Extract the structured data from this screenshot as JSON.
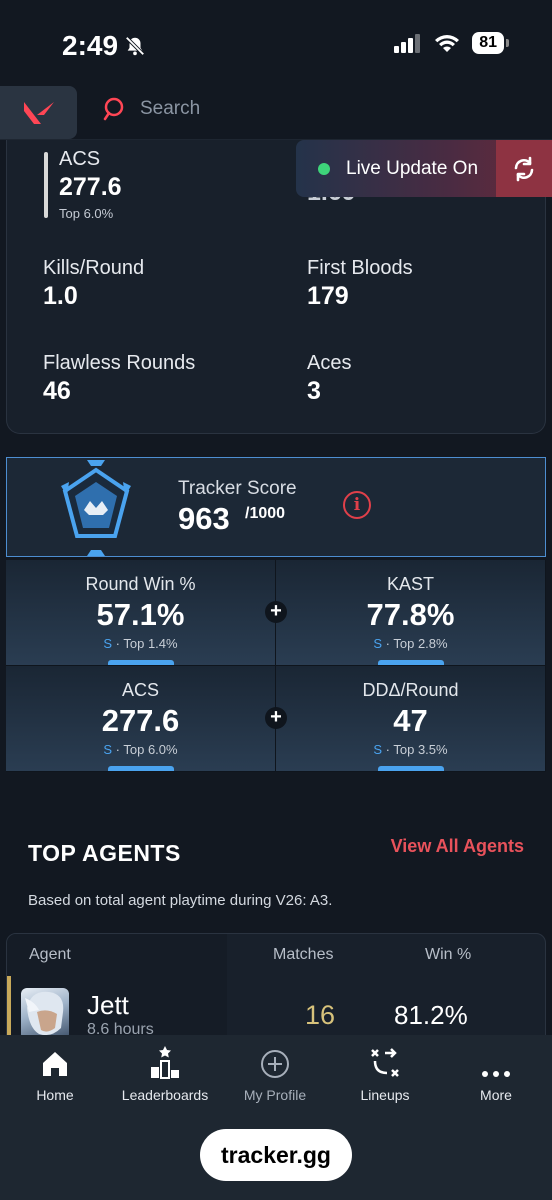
{
  "status_bar": {
    "time": "2:49",
    "battery": "81"
  },
  "header": {
    "search_placeholder": "Search"
  },
  "stats": {
    "acs": {
      "label": "ACS",
      "value": "277.6",
      "sub": "Top 6.0%"
    },
    "kd_partial_value": "1.69",
    "kills_round": {
      "label": "Kills/Round",
      "value": "1.0"
    },
    "first_bloods": {
      "label": "First Bloods",
      "value": "179"
    },
    "flawless": {
      "label": "Flawless Rounds",
      "value": "46"
    },
    "aces": {
      "label": "Aces",
      "value": "3"
    }
  },
  "live_update": {
    "label": "Live Update On"
  },
  "tracker_score": {
    "label": "Tracker Score",
    "value": "963",
    "max": "/1000"
  },
  "metrics": [
    {
      "label": "Round Win %",
      "value": "57.1%",
      "grade": "S",
      "rank": " · Top 1.4%"
    },
    {
      "label": "KAST",
      "value": "77.8%",
      "grade": "S",
      "rank": " · Top 2.8%"
    },
    {
      "label": "ACS",
      "value": "277.6",
      "grade": "S",
      "rank": " · Top 6.0%"
    },
    {
      "label": "DDΔ/Round",
      "value": "47",
      "grade": "S",
      "rank": " · Top 3.5%"
    }
  ],
  "top_agents": {
    "title": "TOP AGENTS",
    "link": "View All Agents",
    "note": "Based on total agent playtime during V26: A3.",
    "columns": {
      "agent": "Agent",
      "matches": "Matches",
      "win": "Win %"
    },
    "rows": [
      {
        "name": "Jett",
        "hours": "8.6 hours",
        "matches": "16",
        "win": "81.2%"
      }
    ]
  },
  "nav": {
    "home": "Home",
    "leaderboards": "Leaderboards",
    "my_profile": "My Profile",
    "lineups": "Lineups",
    "more": "More"
  },
  "url": "tracker.gg",
  "colors": {
    "accent_red": "#e8525b",
    "accent_blue": "#4aa3ef",
    "live_green": "#3ed47a"
  }
}
